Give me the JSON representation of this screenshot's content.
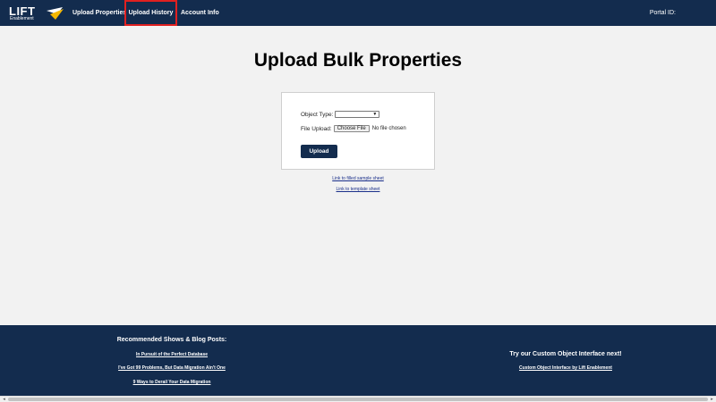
{
  "app": {
    "logo_text": "LIFT",
    "logo_subtext": "Enablement",
    "colors": {
      "navbar": "#132c4e",
      "accent": "#f5b800",
      "highlight_border": "#e02020"
    }
  },
  "nav": {
    "items": [
      {
        "label": "Upload Properties"
      },
      {
        "label": "Upload History"
      },
      {
        "label": "Account Info"
      }
    ],
    "portal_label": "Portal ID:"
  },
  "main": {
    "title": "Upload Bulk Properties",
    "form": {
      "object_type_label": "Object Type:",
      "object_type_value": "",
      "file_upload_label": "File Upload:",
      "choose_file_label": "Choose File",
      "no_file_text": "No file chosen",
      "upload_button": "Upload"
    },
    "links": {
      "sample": "Link to filled sample sheet",
      "template": "Link to template sheet"
    }
  },
  "footer": {
    "left_heading": "Recommended Shows & Blog Posts:",
    "left_links": [
      "In Pursuit of the Perfect Database",
      "I've Got 99 Problems, But Data Migration Ain't One",
      "9 Ways to Derail Your Data Migration"
    ],
    "right_heading": "Try our Custom Object Interface next!",
    "right_link": "Custom Object Interface by Lift Enablement"
  }
}
